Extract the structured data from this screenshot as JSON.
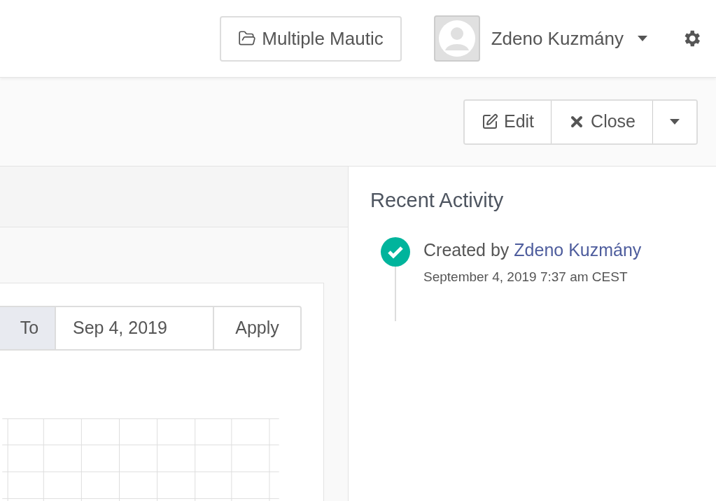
{
  "header": {
    "workspace_button": "Multiple Mautic",
    "user": {
      "name": "Zdeno Kuzmány"
    }
  },
  "toolbar": {
    "buttons": [
      {
        "kind": "edit",
        "label": "Edit"
      },
      {
        "kind": "close",
        "label": "Close"
      },
      {
        "kind": "caret"
      }
    ]
  },
  "date_filter": {
    "to_label": "To",
    "to_value": "Sep 4, 2019",
    "apply": "Apply"
  },
  "recent_activity": {
    "title": "Recent Activity",
    "items": [
      {
        "prefix": "Created by",
        "link": "Zdeno Kuzmány",
        "time": "September 4, 2019 7:37 am CEST"
      }
    ]
  }
}
